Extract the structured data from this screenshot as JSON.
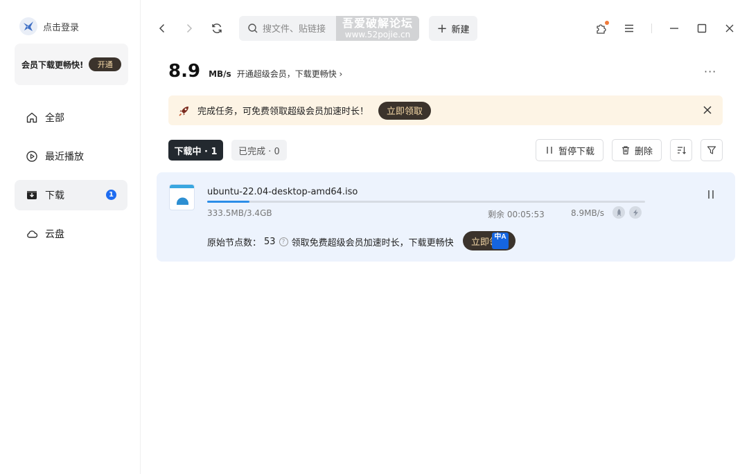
{
  "sidebar": {
    "login_label": "点击登录",
    "vip_text": "会员下载更畅快!",
    "vip_button": "开通",
    "items": [
      {
        "label": "全部",
        "icon": "home-icon"
      },
      {
        "label": "最近播放",
        "icon": "play-circle-icon"
      },
      {
        "label": "下载",
        "icon": "download-box-icon",
        "badge": "1",
        "active": true
      },
      {
        "label": "云盘",
        "icon": "cloud-icon"
      }
    ]
  },
  "topbar": {
    "search_placeholder": "搜文件、贴链接",
    "watermark_line1": "吾爱破解论坛",
    "watermark_line2": "www.52pojie.cn",
    "new_button": "新建"
  },
  "speed": {
    "value": "8.9",
    "unit": "MB/s",
    "promo": "开通超级会员，下载更畅快"
  },
  "banner": {
    "text": "完成任务，可免费领取超级会员加速时长！",
    "button": "立即领取"
  },
  "tabs": {
    "downloading": "下载中 · 1",
    "completed": "已完成 · 0"
  },
  "actions": {
    "pause_all": "暂停下载",
    "delete": "删除"
  },
  "task": {
    "file_name": "ubuntu-22.04-desktop-amd64.iso",
    "size_progress": "333.5MB/3.4GB",
    "remaining": "剩余 00:05:53",
    "speed": "8.9MB/s",
    "progress_fraction": 0.0958,
    "nodes_label": "原始节点数：",
    "nodes_value": "53",
    "promo": "领取免费超级会员加速时长，下载更畅快",
    "button": "立即领",
    "translate_icon_text": "中A"
  },
  "colors": {
    "accent": "#1e6cf0",
    "vip_dark": "#3b332c",
    "vip_gold": "#f5d9a8",
    "task_bg": "#edf3fd",
    "banner_bg": "#fdf4e5"
  }
}
